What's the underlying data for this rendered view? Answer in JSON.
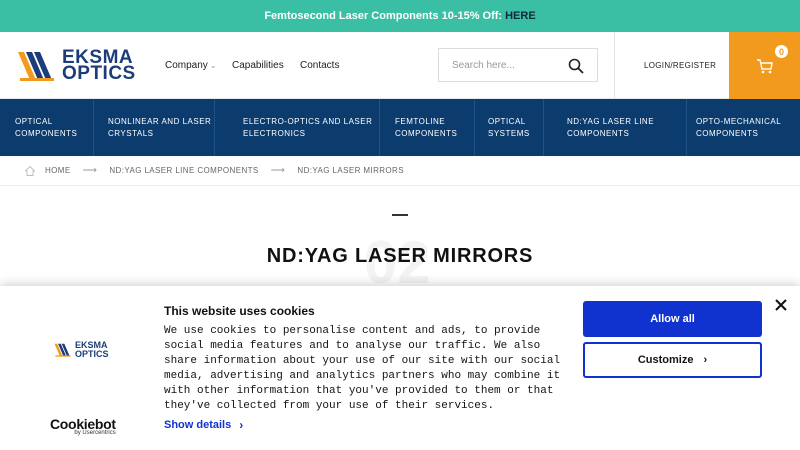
{
  "promo": {
    "text": "Femtosecond Laser Components 10-15% Off:",
    "link": "HERE"
  },
  "header": {
    "logo_line1": "EKSMA",
    "logo_line2": "OPTICS",
    "nav": [
      "Company",
      "Capabilities",
      "Contacts"
    ],
    "search_placeholder": "Search here...",
    "login": "LOGIN/REGISTER",
    "cart_count": "0"
  },
  "categories": [
    "OPTICAL COMPONENTS",
    "NONLINEAR AND LASER CRYSTALS",
    "ELECTRO-OPTICS AND LASER ELECTRONICS",
    "FEMTOLINE COMPONENTS",
    "OPTICAL SYSTEMS",
    "ND:YAG LASER LINE COMPONENTS",
    "OPTO-MECHANICAL COMPONENTS"
  ],
  "breadcrumb": [
    "HOME",
    "ND:YAG LASER LINE COMPONENTS",
    "ND:YAG LASER MIRRORS"
  ],
  "page": {
    "title": "ND:YAG LASER MIRRORS",
    "watermark": "02"
  },
  "cookie": {
    "title": "This website uses cookies",
    "body": "We use cookies to personalise content and ads, to provide social media features and to analyse our traffic. We also share information about your use of our site with our social media, advertising and analytics partners who may combine it with other information that you've provided to them or that they've collected from your use of their services.",
    "show_details": "Show details",
    "allow_all": "Allow all",
    "customize": "Customize",
    "cookiebot_name": "Cookiebot",
    "cookiebot_sub": "by Usercentrics"
  },
  "colors": {
    "promo": "#3bbfa4",
    "navy": "#0c3c6e",
    "cart": "#f29a1d",
    "cookie_blue": "#1032cf"
  }
}
